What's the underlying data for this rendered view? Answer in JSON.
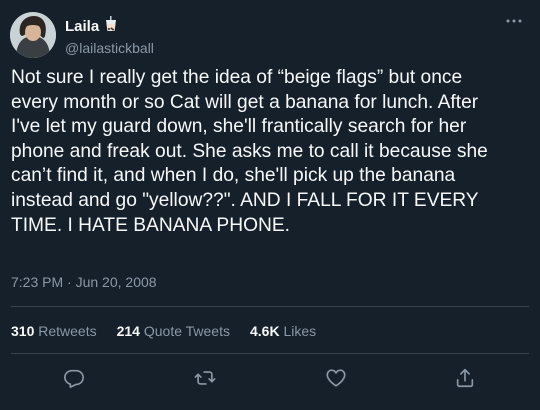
{
  "user": {
    "display_name": "Laila",
    "handle": "@lailastickball",
    "badge_icon": "bubble-tea-emoji-icon"
  },
  "tweet": {
    "text": "Not sure I really get the idea of “beige flags” but once\nevery month or so Cat will get a banana for lunch. After\nI've let my guard down, she'll frantically search for her\nphone and freak out. She asks me to call it because she\ncan’t find it, and when I do, she'll pick up the banana\ninstead and go \"yellow??\". AND I FALL FOR IT EVERY\nTIME. I HATE BANANA PHONE.",
    "time": "7:23 PM",
    "separator": "·",
    "date": "Jun 20, 2008"
  },
  "stats": {
    "retweets_count": "310",
    "retweets_label": "Retweets",
    "quotes_count": "214",
    "quotes_label": "Quote Tweets",
    "likes_count": "4.6K",
    "likes_label": "Likes"
  },
  "actions": [
    "reply-icon",
    "retweet-icon",
    "like-icon",
    "share-icon"
  ],
  "colors": {
    "background": "#15202b",
    "text": "#f7f9f9",
    "secondary": "#8b98a5",
    "divider": "#38444d"
  }
}
